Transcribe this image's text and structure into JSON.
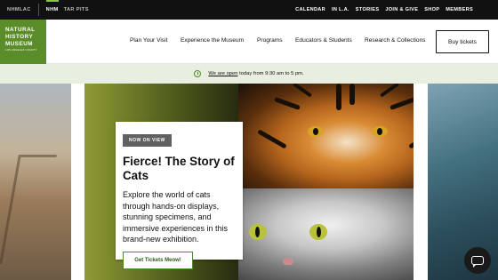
{
  "topbar": {
    "sites": [
      "NHMLAC",
      "NHM",
      "TAR PITS"
    ],
    "active_site": "NHM",
    "utility_links": [
      "CALENDAR",
      "IN L.A.",
      "STORIES",
      "JOIN & GIVE",
      "SHOP",
      "MEMBERS"
    ]
  },
  "logo": {
    "lines": [
      "NATURAL",
      "HISTORY",
      "MUSEUM"
    ],
    "sub": "LOS ANGELES COUNTY"
  },
  "nav": {
    "items": [
      "Plan Your Visit",
      "Experience the Museum",
      "Programs",
      "Educators & Students",
      "Research & Collections"
    ],
    "tickets_label": "Buy tickets"
  },
  "hours": {
    "prefix": "We are open",
    "time": "today from 9:30 am to 5 pm."
  },
  "feature": {
    "tag": "NOW ON VIEW",
    "title": "Fierce! The Story of Cats",
    "description": "Explore the world of cats through hands-on displays, stunning specimens, and immersive experiences in this brand-new exhibition.",
    "cta_label": "Get Tickets Meow!"
  },
  "colors": {
    "brand_green": "#5b8c2a",
    "topbar_bg": "#111111",
    "hours_bg": "#e9efe0",
    "accent_line": "#8cc63f"
  },
  "icons": {
    "hours": "clock-icon",
    "chat": "chat-icon"
  }
}
